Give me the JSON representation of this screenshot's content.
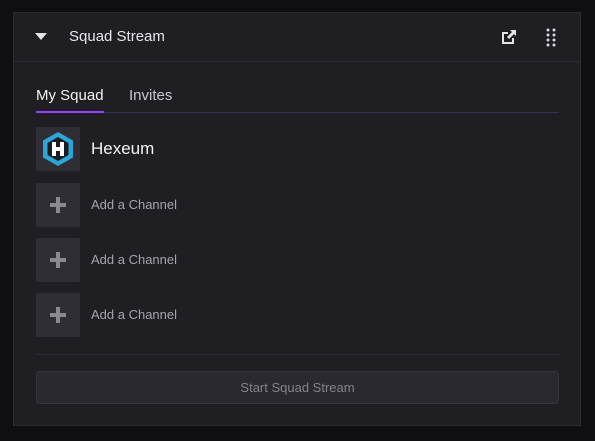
{
  "panel": {
    "title": "Squad Stream",
    "icons": {
      "collapse": "caret-down-icon",
      "popout": "popout-icon",
      "more": "more-vertical-icon"
    }
  },
  "tabs": [
    {
      "label": "My Squad",
      "active": true
    },
    {
      "label": "Invites",
      "active": false
    }
  ],
  "squad": {
    "host": {
      "name": "Hexeum",
      "logo_letter": "H"
    },
    "slots": [
      {
        "label": "Add a Channel"
      },
      {
        "label": "Add a Channel"
      },
      {
        "label": "Add a Channel"
      }
    ]
  },
  "actions": {
    "start_label": "Start Squad Stream"
  },
  "colors": {
    "accent": "#9147ff",
    "logo_blue": "#2aa7d8",
    "panel_bg": "#1f1e23",
    "page_bg": "#0f0e11"
  }
}
